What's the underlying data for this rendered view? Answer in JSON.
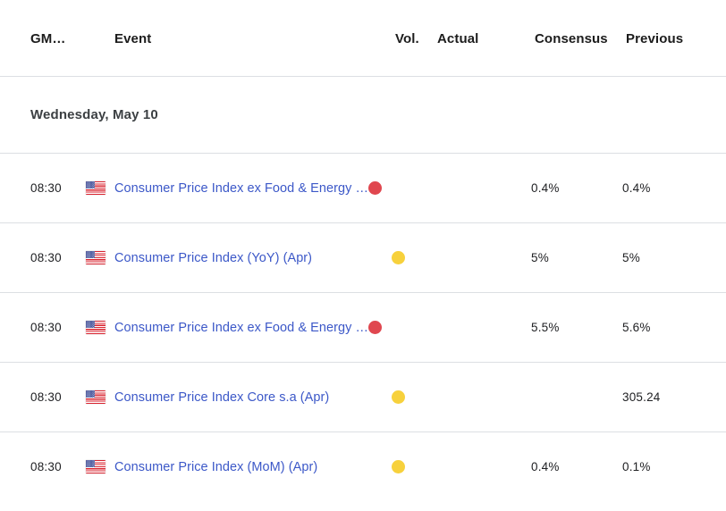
{
  "table": {
    "columns": {
      "time": "GM…",
      "event": "Event",
      "volatility": "Vol.",
      "actual": "Actual",
      "consensus": "Consensus",
      "previous": "Previous"
    },
    "date_group": "Wednesday, May 10",
    "rows": [
      {
        "time": "08:30",
        "country": "us-flag",
        "event": "Consumer Price Index ex Food & Energy …",
        "volatility": "high",
        "volatility_color": "#e0474f",
        "actual": "",
        "consensus": "0.4%",
        "previous": "0.4%"
      },
      {
        "time": "08:30",
        "country": "us-flag",
        "event": "Consumer Price Index (YoY) (Apr)",
        "volatility": "medium",
        "volatility_color": "#f7d13c",
        "actual": "",
        "consensus": "5%",
        "previous": "5%"
      },
      {
        "time": "08:30",
        "country": "us-flag",
        "event": "Consumer Price Index ex Food & Energy …",
        "volatility": "high",
        "volatility_color": "#e0474f",
        "actual": "",
        "consensus": "5.5%",
        "previous": "5.6%"
      },
      {
        "time": "08:30",
        "country": "us-flag",
        "event": "Consumer Price Index Core s.a (Apr)",
        "volatility": "medium",
        "volatility_color": "#f7d13c",
        "actual": "",
        "consensus": "",
        "previous": "305.24"
      },
      {
        "time": "08:30",
        "country": "us-flag",
        "event": "Consumer Price Index (MoM) (Apr)",
        "volatility": "medium",
        "volatility_color": "#f7d13c",
        "actual": "",
        "consensus": "0.4%",
        "previous": "0.1%"
      }
    ]
  },
  "theme": {
    "link_color": "#3c58c8",
    "text_color": "#202124",
    "header_color": "#1c1c1c",
    "date_color": "#3c4043",
    "separator_color": "#dcdfe3",
    "background": "#ffffff"
  }
}
